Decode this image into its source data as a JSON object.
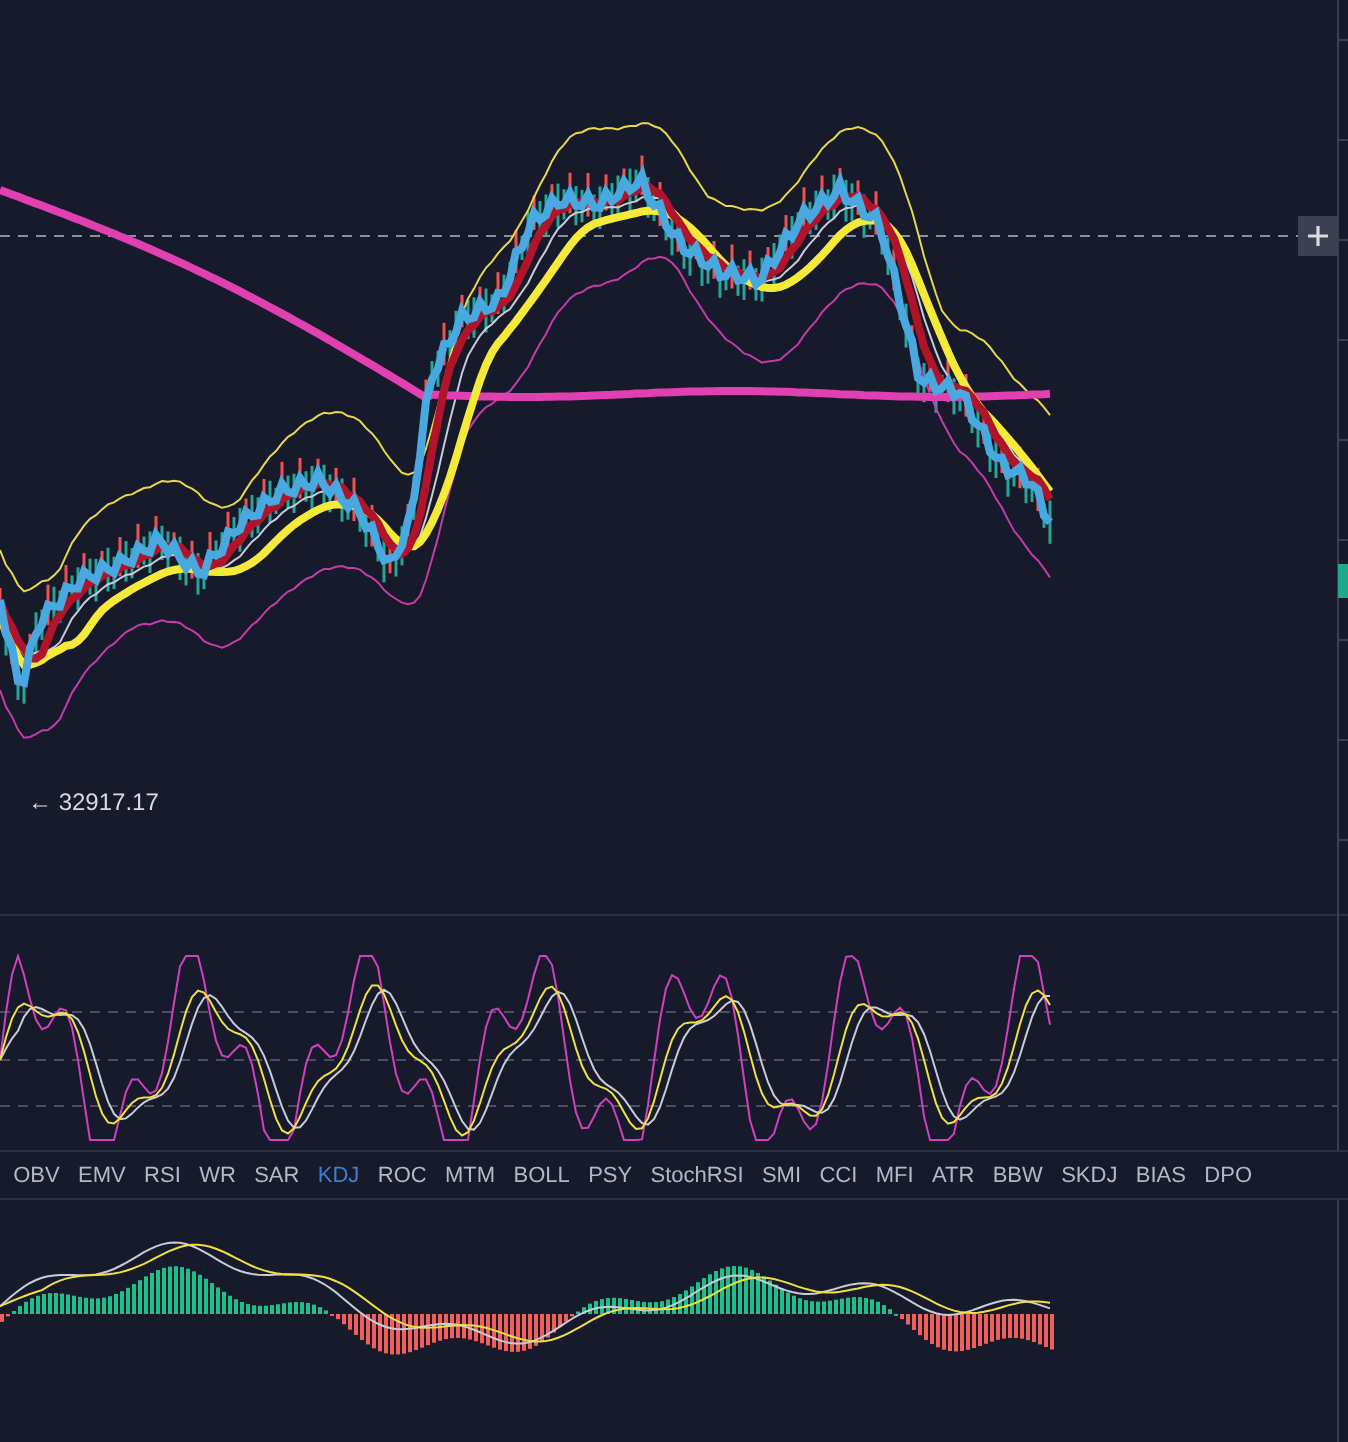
{
  "main_chart": {
    "low_label": "← 32917.17"
  },
  "indicator_tabs": [
    {
      "label": "OBV",
      "selected": false
    },
    {
      "label": "EMV",
      "selected": false
    },
    {
      "label": "RSI",
      "selected": false
    },
    {
      "label": "WR",
      "selected": false
    },
    {
      "label": "SAR",
      "selected": false
    },
    {
      "label": "KDJ",
      "selected": true
    },
    {
      "label": "ROC",
      "selected": false
    },
    {
      "label": "MTM",
      "selected": false
    },
    {
      "label": "BOLL",
      "selected": false
    },
    {
      "label": "PSY",
      "selected": false
    },
    {
      "label": "StochRSI",
      "selected": false
    },
    {
      "label": "SMI",
      "selected": false
    },
    {
      "label": "CCI",
      "selected": false
    },
    {
      "label": "MFI",
      "selected": false
    },
    {
      "label": "ATR",
      "selected": false
    },
    {
      "label": "BBW",
      "selected": false
    },
    {
      "label": "SKDJ",
      "selected": false
    },
    {
      "label": "BIAS",
      "selected": false
    },
    {
      "label": "DPO",
      "selected": false
    }
  ]
}
